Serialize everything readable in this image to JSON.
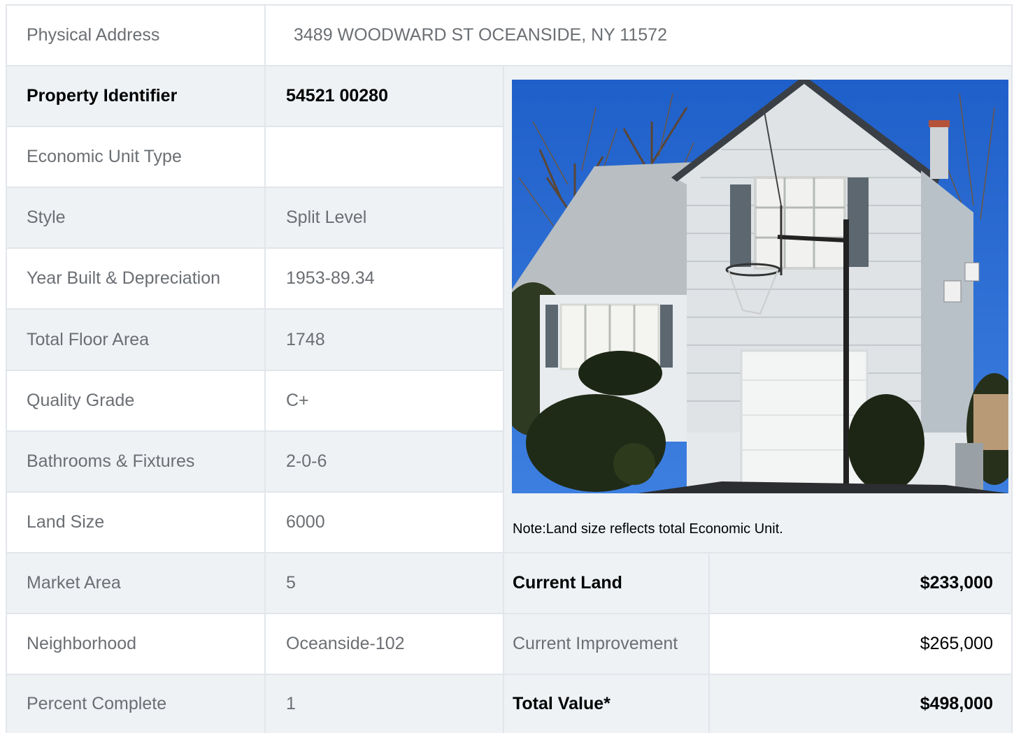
{
  "address": {
    "label": "Physical Address",
    "value": "3489  WOODWARD ST  OCEANSIDE, NY  11572"
  },
  "details": [
    {
      "label": "Property Identifier",
      "value": "54521  00280"
    },
    {
      "label": "Economic Unit Type",
      "value": ""
    },
    {
      "label": "Style",
      "value": "Split Level"
    },
    {
      "label": "Year Built & Depreciation",
      "value": "1953-89.34"
    },
    {
      "label": "Total Floor Area",
      "value": "1748"
    },
    {
      "label": "Quality Grade",
      "value": "C+"
    },
    {
      "label": "Bathrooms & Fixtures",
      "value": "2-0-6"
    },
    {
      "label": "Land Size",
      "value": "6000"
    },
    {
      "label": "Market Area",
      "value": "5"
    },
    {
      "label": "Neighborhood",
      "value": "Oceanside-102"
    },
    {
      "label": "Percent Complete",
      "value": "1"
    }
  ],
  "photo_note": "Note:Land size reflects total Economic Unit.",
  "valuation": [
    {
      "label": "Current Land",
      "value": "$233,000"
    },
    {
      "label": "Current Improvement",
      "value": "$265,000"
    },
    {
      "label": "Total Value*",
      "value": "$498,000"
    }
  ],
  "colors": {
    "shaded_row": "#eef2f5",
    "border": "#e2e6ea",
    "label_text": "#6b6f73",
    "bold_text": "#000000"
  }
}
